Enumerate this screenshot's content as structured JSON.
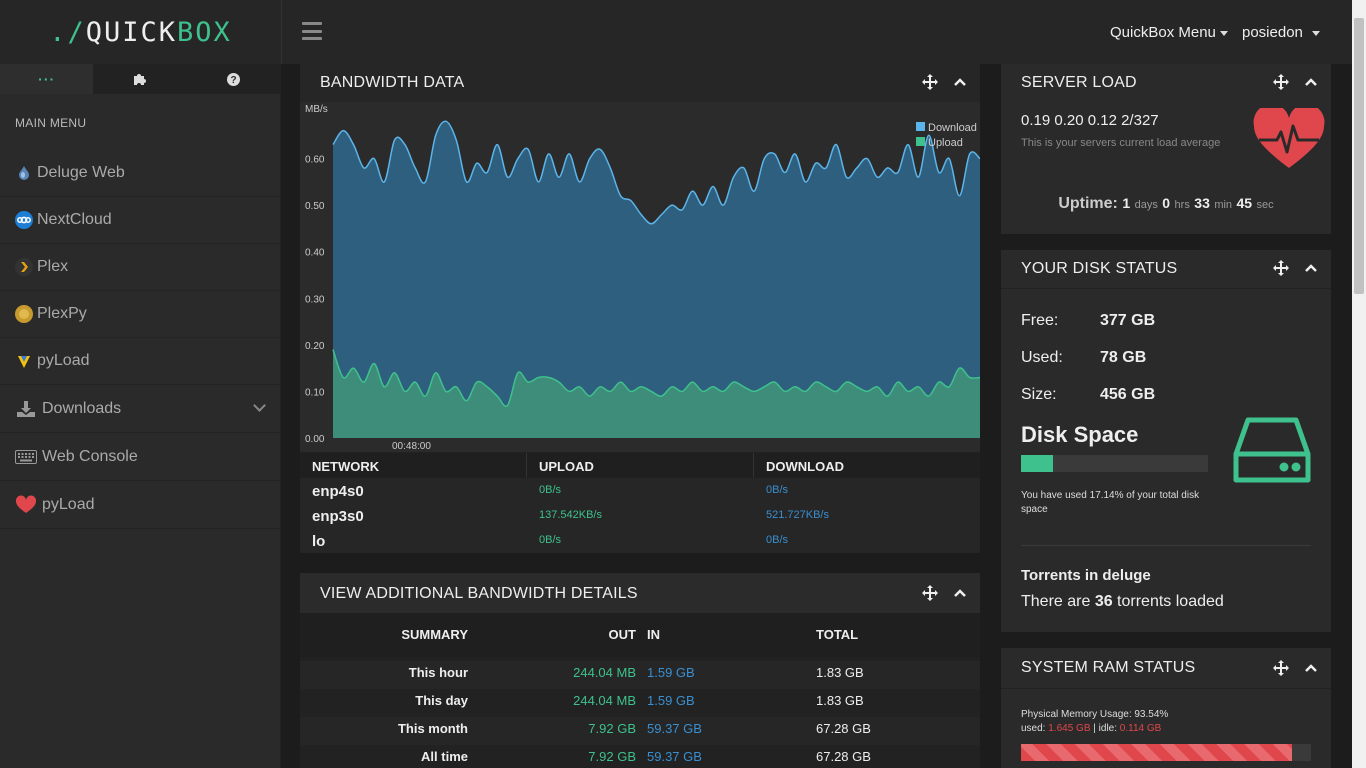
{
  "brand": {
    "prefix": "./",
    "name_a": "QUICK",
    "name_b": "BOX"
  },
  "topbar": {
    "quickbox_menu": "QuickBox Menu",
    "user": "posiedon"
  },
  "sidebar": {
    "title": "MAIN MENU",
    "items": [
      {
        "label": "Deluge Web",
        "icon": "deluge-icon"
      },
      {
        "label": "NextCloud",
        "icon": "nextcloud-icon"
      },
      {
        "label": "Plex",
        "icon": "plex-icon"
      },
      {
        "label": "PlexPy",
        "icon": "plexpy-icon"
      },
      {
        "label": "pyLoad",
        "icon": "pyload-icon"
      },
      {
        "label": "Downloads",
        "icon": "download-icon"
      },
      {
        "label": "Web Console",
        "icon": "keyboard-icon"
      },
      {
        "label": "pyLoad",
        "icon": "heart-icon"
      }
    ]
  },
  "bandwidth": {
    "title": "BANDWIDTH DATA",
    "table_headers": {
      "network": "NETWORK",
      "upload": "UPLOAD",
      "download": "DOWNLOAD"
    },
    "rows": [
      {
        "iface": "enp4s0",
        "upload": "0B/s",
        "download": "0B/s"
      },
      {
        "iface": "enp3s0",
        "upload": "137.542KB/s",
        "download": "521.727KB/s"
      },
      {
        "iface": "lo",
        "upload": "0B/s",
        "download": "0B/s"
      }
    ]
  },
  "chart_data": {
    "type": "area",
    "ylabel": "MB/s",
    "ylim": [
      0,
      0.7
    ],
    "yticks": [
      "0.00",
      "0.10",
      "0.20",
      "0.30",
      "0.40",
      "0.50",
      "0.60"
    ],
    "xtick": "00:48:00",
    "legend_position": "top-right",
    "series": [
      {
        "name": "Download",
        "color": "#5bb5ea",
        "values": [
          0.63,
          0.66,
          0.63,
          0.58,
          0.6,
          0.55,
          0.64,
          0.63,
          0.58,
          0.55,
          0.65,
          0.68,
          0.64,
          0.55,
          0.59,
          0.57,
          0.63,
          0.56,
          0.6,
          0.62,
          0.55,
          0.61,
          0.56,
          0.61,
          0.55,
          0.6,
          0.62,
          0.58,
          0.52,
          0.51,
          0.48,
          0.46,
          0.48,
          0.5,
          0.49,
          0.53,
          0.5,
          0.54,
          0.5,
          0.56,
          0.58,
          0.53,
          0.6,
          0.61,
          0.57,
          0.61,
          0.55,
          0.59,
          0.58,
          0.63,
          0.56,
          0.58,
          0.6,
          0.56,
          0.58,
          0.57,
          0.63,
          0.56,
          0.65,
          0.57,
          0.6,
          0.52,
          0.61,
          0.6
        ]
      },
      {
        "name": "Upload",
        "color": "#3ec18c",
        "values": [
          0.19,
          0.13,
          0.15,
          0.12,
          0.16,
          0.11,
          0.14,
          0.1,
          0.12,
          0.09,
          0.14,
          0.1,
          0.11,
          0.08,
          0.12,
          0.11,
          0.09,
          0.07,
          0.14,
          0.12,
          0.13,
          0.13,
          0.12,
          0.1,
          0.11,
          0.09,
          0.11,
          0.1,
          0.12,
          0.1,
          0.11,
          0.1,
          0.09,
          0.11,
          0.1,
          0.12,
          0.1,
          0.11,
          0.1,
          0.12,
          0.11,
          0.1,
          0.11,
          0.12,
          0.1,
          0.11,
          0.1,
          0.12,
          0.11,
          0.1,
          0.12,
          0.11,
          0.1,
          0.11,
          0.09,
          0.12,
          0.1,
          0.11,
          0.09,
          0.12,
          0.11,
          0.15,
          0.13,
          0.13
        ]
      }
    ]
  },
  "details": {
    "title": "VIEW ADDITIONAL BANDWIDTH DETAILS",
    "headers": {
      "summary": "SUMMARY",
      "out": "OUT",
      "in": "IN",
      "total": "TOTAL"
    },
    "rows": [
      {
        "label": "This hour",
        "out": "244.04 MB",
        "in": "1.59 GB",
        "total": "1.83 GB"
      },
      {
        "label": "This day",
        "out": "244.04 MB",
        "in": "1.59 GB",
        "total": "1.83 GB"
      },
      {
        "label": "This month",
        "out": "7.92 GB",
        "in": "59.37 GB",
        "total": "67.28 GB"
      },
      {
        "label": "All time",
        "out": "7.92 GB",
        "in": "59.37 GB",
        "total": "67.28 GB"
      }
    ]
  },
  "server_load": {
    "title": "SERVER LOAD",
    "values": "0.19 0.20 0.12 2/327",
    "caption": "This is your servers current load average",
    "uptime_label": "Uptime:",
    "days": "1",
    "days_unit": "days",
    "hrs": "0",
    "hrs_unit": "hrs",
    "min": "33",
    "min_unit": "min",
    "sec": "45",
    "sec_unit": "sec"
  },
  "disk": {
    "title": "YOUR DISK STATUS",
    "free_label": "Free:",
    "free": "377 GB",
    "used_label": "Used:",
    "used": "78 GB",
    "size_label": "Size:",
    "size": "456 GB",
    "heading": "Disk Space",
    "used_percent": 17.14,
    "note": "You have used 17.14% of your total disk space",
    "torrents_title": "Torrents in deluge",
    "torrents_pre": "There are ",
    "torrents_count": "36",
    "torrents_post": " torrents loaded"
  },
  "ram": {
    "title": "SYSTEM RAM STATUS",
    "usage": "Physical Memory Usage: 93.54%",
    "used_label": "used: ",
    "used": "1.645 GB",
    "sep": " | idle: ",
    "idle": "0.114 GB",
    "percent": 93.54
  },
  "colors": {
    "accent": "#3ec18c",
    "blue": "#3a8fd0",
    "red": "#e0474c"
  }
}
